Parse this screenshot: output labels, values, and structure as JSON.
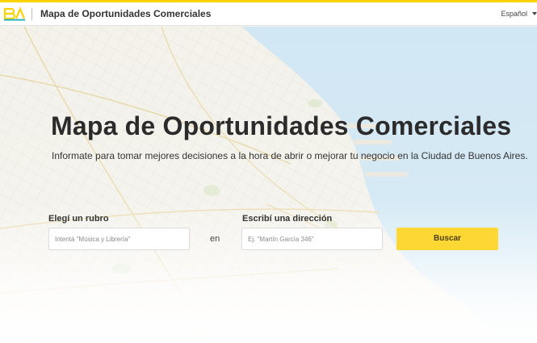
{
  "header": {
    "title": "Mapa de Oportunidades Comerciales",
    "language": "Español"
  },
  "hero": {
    "title": "Mapa de Oportunidades Comerciales",
    "subtitle": "Informate para tomar mejores decisiones a la hora de abrir o mejorar tu negocio en la Ciudad de Buenos Aires."
  },
  "search": {
    "rubro_label": "Elegí un rubro",
    "rubro_placeholder": "Intentá \"Música y Librería\"",
    "connector": "en",
    "direccion_label": "Escribí una dirección",
    "direccion_placeholder": "Ej. \"Martín García 346\"",
    "button": "Buscar"
  },
  "colors": {
    "accent": "#fdd306",
    "button": "#fdd835",
    "water": "#cfe6f3",
    "land": "#f3f1ea"
  }
}
